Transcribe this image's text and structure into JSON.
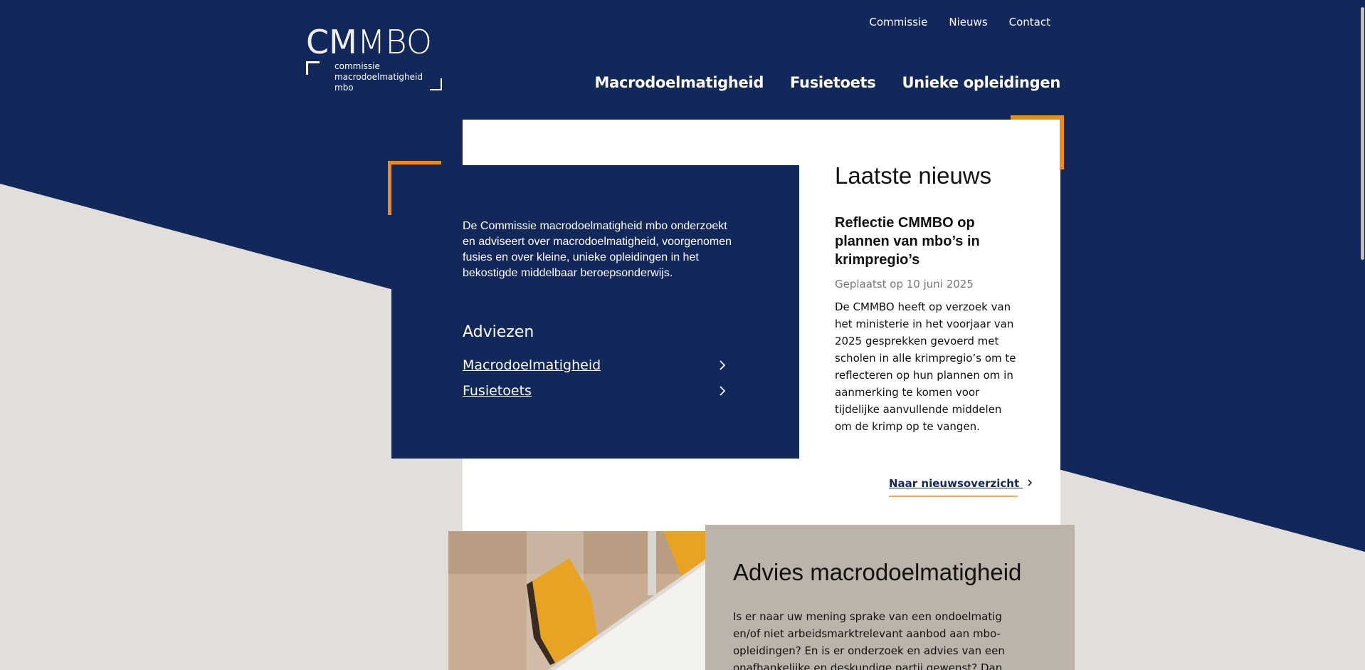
{
  "colors": {
    "navy": "#12275a",
    "orange": "#f08a1e",
    "beige_background": "#e2dedb",
    "beige_panel": "#bcb3aa"
  },
  "logo": {
    "wordmark_left": "CM",
    "wordmark_right": "MBO",
    "subtitle_line1": "commissie",
    "subtitle_line2": "macrodoelmatigheid",
    "subtitle_line3": "mbo"
  },
  "top_nav": [
    "Commissie",
    "Nieuws",
    "Contact"
  ],
  "main_nav": [
    "Macrodoelmatigheid",
    "Fusietoets",
    "Unieke opleidingen"
  ],
  "intro_text": "De Commissie macrodoelmatigheid mbo onderzoekt en adviseert over macrodoelmatigheid, voorgenomen fusies en over kleine, unieke opleidingen in het bekostigde middelbaar beroepsonderwijs.",
  "adviezen": {
    "title": "Adviezen",
    "links": [
      "Macrodoelmatigheid",
      "Fusietoets"
    ],
    "chevron_icon": "chevron-right-icon"
  },
  "news": {
    "section_title": "Laatste nieuws",
    "headline": "Reflectie CMMBO op plannen van mbo’s in krimpregio’s",
    "date": "Geplaatst op 10 juni 2025",
    "body": "De CMMBO heeft op verzoek van het ministerie in het voorjaar van 2025 gesprekken gevoerd met scholen in alle krimpregio’s om te reflecteren op hun plannen om in aanmerking te komen voor tijdelijke aanvullende middelen om de krimp op te vangen.",
    "more_link": "Naar nieuwsoverzicht",
    "more_icon": "chevron-right-icon"
  },
  "advies_panel": {
    "title": "Advies macrodoelmatigheid",
    "body": "Is er naar uw mening sprake van een ondoelmatig en/of niet arbeidsmarktrelevant aanbod aan mbo-opleidingen? En is er onderzoek en advies van een onafhankelijke en deskundige partij gewenst? Dan kunt u een verzoek"
  }
}
